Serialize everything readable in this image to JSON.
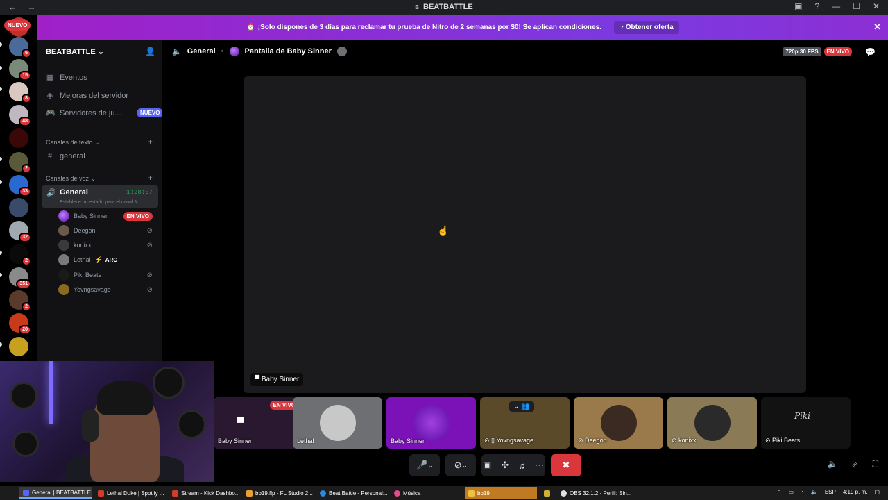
{
  "window": {
    "title": "BEATBATTLE",
    "logo_glyph": "B",
    "nav": "← →"
  },
  "servers": {
    "nuevo_label": "NUEVO",
    "badges": [
      "6",
      "15",
      "8",
      "48",
      "2",
      "33",
      "32",
      "2",
      "351",
      "2",
      "20"
    ]
  },
  "promo": {
    "message": "¡Solo dispones de 3 días para reclamar tu prueba de Nitro de 2 semanas por $0! Se aplican condiciones.",
    "offer_label": "Obtener oferta",
    "colors": {
      "start": "#a020c8",
      "end": "#7a3ae0"
    }
  },
  "sidebar": {
    "server_name": "BEATBATTLE",
    "items": [
      {
        "label": "Eventos",
        "icon": "calendar-icon"
      },
      {
        "label": "Mejoras del servidor",
        "icon": "boost-icon"
      },
      {
        "label": "Servidores de ju...",
        "icon": "gamepad-icon",
        "tag": "NUEVO"
      }
    ],
    "text_category": "Canales de texto",
    "text_channel": "general",
    "voice_category": "Canales de voz",
    "voice_channel": {
      "name": "General",
      "time": "1:28:07",
      "status": "Establece un estado para el canal"
    },
    "members": [
      {
        "name": "Baby Sinner",
        "badge": "EN VIVO",
        "color": "#8a2be2"
      },
      {
        "name": "Deegon",
        "color": "#6b5a4a"
      },
      {
        "name": "konixx",
        "color": "#3a3a3a"
      },
      {
        "name": "Lethal",
        "extra": "ARC",
        "color": "#7a7a7a"
      },
      {
        "name": "Piki Beats",
        "color": "#1a1a1a"
      },
      {
        "name": "Yovngsavage",
        "color": "#8a6a20"
      }
    ]
  },
  "stream": {
    "channel": "General",
    "title": "Pantalla de Baby Sinner",
    "quality": "720p 30 FPS",
    "live_label": "EN VIVO",
    "stage_label": "Baby Sinner"
  },
  "tiles": [
    {
      "name": "Baby Sinner",
      "live": "EN VIVO",
      "bg": "#2a1830"
    },
    {
      "name": "Lethal",
      "bg": "#6d6f72"
    },
    {
      "name": "Baby Sinner",
      "bg": "#7a12b8"
    },
    {
      "name": "Yovngsavage",
      "bg": "#5a4a2a"
    },
    {
      "name": "Deegon",
      "bg": "#9a7a4a"
    },
    {
      "name": "konixx",
      "bg": "#8a7a55"
    },
    {
      "name": "Piki Beats",
      "bg": "#121212"
    }
  ],
  "taskbar": {
    "apps": [
      {
        "label": "General | BEATBATTLE...",
        "color": "#5865f2"
      },
      {
        "label": "Lethal Duke | Spotify ...",
        "color": "#d43c2a"
      },
      {
        "label": "Stream - Kick Dashbo...",
        "color": "#d43c2a"
      },
      {
        "label": "bb19.flp - FL Studio 2...",
        "color": "#e8a030"
      },
      {
        "label": "Beat Battle - Personal:...",
        "color": "#2a8ae0"
      },
      {
        "label": "Música",
        "color": "#e84a8a"
      },
      {
        "label": "bb19",
        "color": "#f0c040"
      },
      {
        "label": "",
        "color": "#d4b030"
      },
      {
        "label": "OBS 32.1.2 - Perfil: Sin...",
        "color": "#e0e0e0"
      }
    ],
    "lang": "ESP",
    "time": "4:19 p. m."
  }
}
